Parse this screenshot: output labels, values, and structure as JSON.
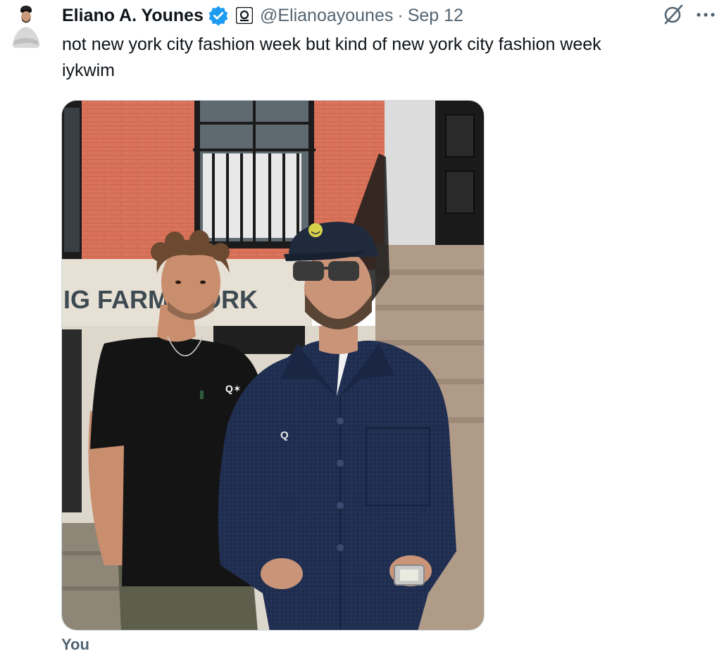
{
  "tweet": {
    "author_name": "Eliano A. Younes",
    "handle": "@Elianoayounes",
    "separator": "·",
    "date": "Sep 12",
    "text": "not new york city fashion week but kind of new york city fashion week\niykwim",
    "verified": true,
    "affiliation_badge": "brand-logo-badge",
    "icons": [
      "verified-badge-icon",
      "grok-icon",
      "more-icon"
    ]
  },
  "media": {
    "type": "photo",
    "sign_text": "IG FARM N    ORK",
    "shirt_logo": "Q✶",
    "jacket_logo": "Q",
    "cap_logo": "smiley"
  },
  "footer": {
    "tagged_label": "You"
  },
  "colors": {
    "verified_blue": "#1d9bf0",
    "secondary_text": "#536471",
    "primary_text": "#0f1419"
  }
}
